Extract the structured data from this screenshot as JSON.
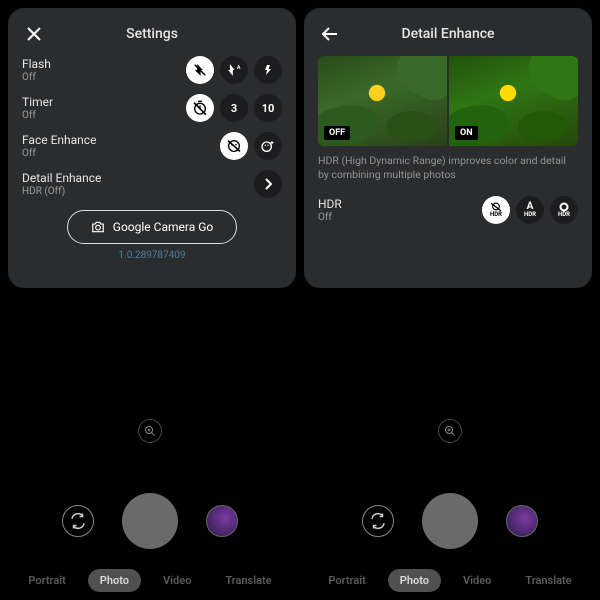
{
  "left_panel": {
    "title": "Settings",
    "rows": {
      "flash": {
        "label": "Flash",
        "sub": "Off",
        "options": [
          "off",
          "auto",
          "on"
        ]
      },
      "timer": {
        "label": "Timer",
        "sub": "Off",
        "options": [
          "off",
          "3",
          "10"
        ],
        "opt_3": "3",
        "opt_10": "10"
      },
      "face": {
        "label": "Face Enhance",
        "sub": "Off",
        "options": [
          "off",
          "on"
        ]
      },
      "detail": {
        "label": "Detail Enhance",
        "sub": "HDR (Off)"
      }
    },
    "button_label": "Google Camera Go",
    "version": "1.0.289787409"
  },
  "right_panel": {
    "title": "Detail Enhance",
    "preview": {
      "off_label": "OFF",
      "on_label": "ON"
    },
    "description": "HDR (High Dynamic Range) improves color and detail by combining multiple photos",
    "hdr": {
      "label": "HDR",
      "sub": "Off",
      "options": [
        "off",
        "auto",
        "on"
      ],
      "small_label": "HDR"
    }
  },
  "camera": {
    "modes": {
      "portrait": "Portrait",
      "photo": "Photo",
      "video": "Video",
      "translate": "Translate"
    }
  },
  "icons": {
    "close": "close-icon",
    "back": "back-icon",
    "flash_off": "flash-off-icon",
    "flash_auto": "flash-auto-icon",
    "flash_on": "flash-on-icon",
    "timer_off": "timer-off-icon",
    "face_off": "face-enhance-off-icon",
    "face_on": "face-enhance-on-icon",
    "chevron": "chevron-right-icon",
    "camera": "camera-icon",
    "zoom": "zoom-in-icon",
    "switch": "switch-camera-icon",
    "hdr_off": "hdr-off-icon",
    "hdr_auto": "hdr-auto-icon",
    "hdr_on": "hdr-on-icon"
  },
  "colors": {
    "panel": "#2b2c2e",
    "chip_sel": "#ffffff",
    "accent": "#4a7fa0"
  }
}
